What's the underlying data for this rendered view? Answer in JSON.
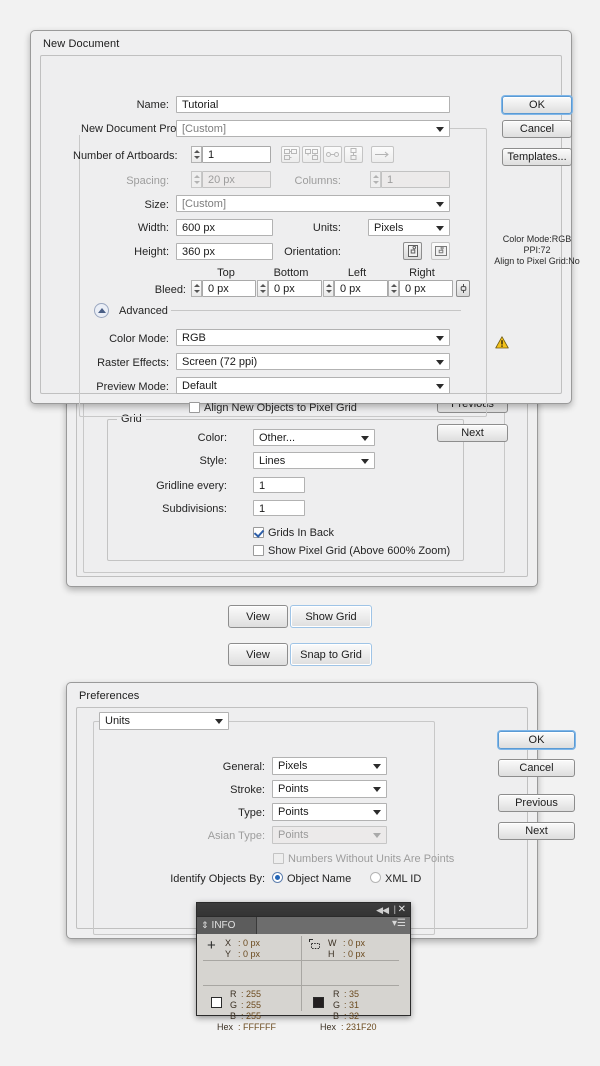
{
  "app": "Adobe Illustrator dialogs composite",
  "new_document": {
    "title": "New Document",
    "fields": {
      "name_label": "Name:",
      "name_value": "Tutorial",
      "profile_label": "New Document Profile:",
      "profile_value": "[Custom]",
      "artboards_label": "Number of Artboards:",
      "artboards_value": "1",
      "spacing_label": "Spacing:",
      "spacing_value": "20 px",
      "columns_label": "Columns:",
      "columns_value": "1",
      "size_label": "Size:",
      "size_value": "[Custom]",
      "width_label": "Width:",
      "width_value": "600 px",
      "units_label": "Units:",
      "units_value": "Pixels",
      "height_label": "Height:",
      "height_value": "360 px",
      "orientation_label": "Orientation:",
      "bleed_label": "Bleed:",
      "bleed_top_header": "Top",
      "bleed_bottom_header": "Bottom",
      "bleed_left_header": "Left",
      "bleed_right_header": "Right",
      "bleed_top": "0 px",
      "bleed_bottom": "0 px",
      "bleed_left": "0 px",
      "bleed_right": "0 px",
      "advanced_label": "Advanced",
      "color_mode_label": "Color Mode:",
      "color_mode_value": "RGB",
      "raster_label": "Raster Effects:",
      "raster_value": "Screen (72 ppi)",
      "preview_label": "Preview Mode:",
      "preview_value": "Default",
      "align_pixel_label": "Align New Objects to Pixel Grid",
      "align_pixel_checked": false
    },
    "buttons": {
      "ok": "OK",
      "cancel": "Cancel",
      "templates": "Templates..."
    },
    "summary": {
      "line1": "Color Mode:RGB",
      "line2": "PPI:72",
      "line3": "Align to Pixel Grid:No"
    }
  },
  "grid_prefs": {
    "group_title": "Grid",
    "color_label": "Color:",
    "color_value": "Other...",
    "color_swatch": "#b0b0b0",
    "style_label": "Style:",
    "style_value": "Lines",
    "gridline_label": "Gridline every:",
    "gridline_value": "1",
    "subdivisions_label": "Subdivisions:",
    "subdivisions_value": "1",
    "grids_in_back_label": "Grids In Back",
    "grids_in_back_checked": true,
    "pixel_grid_label": "Show Pixel Grid (Above 600% Zoom)",
    "pixel_grid_checked": false,
    "buttons": {
      "previous": "Previous",
      "next": "Next"
    }
  },
  "menu_paths": [
    {
      "menu": "View",
      "item": "Show Grid"
    },
    {
      "menu": "View",
      "item": "Snap to Grid"
    }
  ],
  "preferences": {
    "title": "Preferences",
    "section_value": "Units",
    "rows": [
      {
        "label": "General:",
        "value": "Pixels",
        "disabled": false
      },
      {
        "label": "Stroke:",
        "value": "Points",
        "disabled": false
      },
      {
        "label": "Type:",
        "value": "Points",
        "disabled": false
      },
      {
        "label": "Asian Type:",
        "value": "Points",
        "disabled": true
      }
    ],
    "numbers_without_units_label": "Numbers Without Units Are Points",
    "numbers_without_units_checked": false,
    "identify_label": "Identify Objects By:",
    "identify_options": [
      {
        "label": "Object Name",
        "selected": true
      },
      {
        "label": "XML ID",
        "selected": false
      }
    ],
    "buttons": {
      "ok": "OK",
      "cancel": "Cancel",
      "previous": "Previous",
      "next": "Next"
    }
  },
  "info_panel": {
    "tab_label": "INFO",
    "coords": {
      "x_label": "X",
      "x_value": ": 0 px",
      "y_label": "Y",
      "y_value": ": 0 px"
    },
    "size": {
      "w_label": "W",
      "w_value": ": 0 px",
      "h_label": "H",
      "h_value": ": 0 px"
    },
    "fill": {
      "r_label": "R",
      "r_value": ": 255",
      "g_label": "G",
      "g_value": ": 255",
      "b_label": "B",
      "b_value": ": 255",
      "hex_label": "Hex",
      "hex_value": ": FFFFFF"
    },
    "stroke": {
      "r_label": "R",
      "r_value": ": 35",
      "g_label": "G",
      "g_value": ": 31",
      "b_label": "B",
      "b_value": ": 32",
      "hex_label": "Hex",
      "hex_value": ": 231F20"
    }
  }
}
